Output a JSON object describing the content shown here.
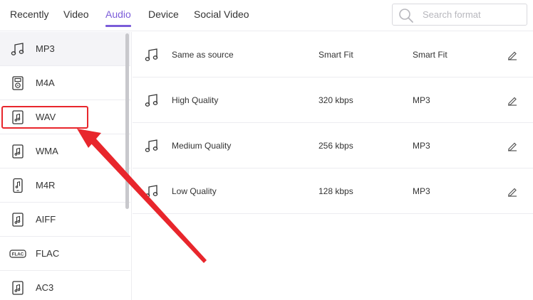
{
  "tabs": [
    {
      "label": "Recently",
      "active": false
    },
    {
      "label": "Video",
      "active": false
    },
    {
      "label": "Audio",
      "active": true
    },
    {
      "label": "Device",
      "active": false
    },
    {
      "label": "Social Video",
      "active": false
    }
  ],
  "search": {
    "placeholder": "Search format",
    "value": "",
    "icon": "search-icon"
  },
  "sidebar": {
    "formats": [
      {
        "label": "MP3",
        "icon": "music-note-icon",
        "selected": true
      },
      {
        "label": "M4A",
        "icon": "ipod-icon"
      },
      {
        "label": "WAV",
        "icon": "music-file-icon",
        "highlighted": true
      },
      {
        "label": "WMA",
        "icon": "music-file-icon"
      },
      {
        "label": "M4R",
        "icon": "phone-music-icon"
      },
      {
        "label": "AIFF",
        "icon": "music-file-icon"
      },
      {
        "label": "FLAC",
        "icon": "flac-icon"
      },
      {
        "label": "AC3",
        "icon": "music-file-icon"
      }
    ]
  },
  "presets": [
    {
      "name": "Same as source",
      "bitrate": "Smart Fit",
      "format": "Smart Fit"
    },
    {
      "name": "High Quality",
      "bitrate": "320 kbps",
      "format": "MP3"
    },
    {
      "name": "Medium Quality",
      "bitrate": "256 kbps",
      "format": "MP3"
    },
    {
      "name": "Low Quality",
      "bitrate": "128 kbps",
      "format": "MP3"
    }
  ],
  "colors": {
    "accent": "#7b5cd9",
    "annotation": "#e8262c"
  }
}
